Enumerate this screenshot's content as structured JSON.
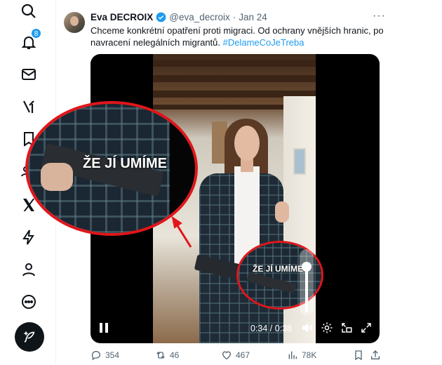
{
  "nav": {
    "notifications_badge": "8",
    "icons": [
      "search-icon",
      "bell-icon",
      "mail-icon",
      "grok-icon",
      "bookmark-icon",
      "communities-icon",
      "x-logo-icon",
      "bolt-icon",
      "profile-icon",
      "more-circle-icon"
    ]
  },
  "tweet": {
    "author_name": "Eva DECROIX",
    "handle": "@eva_decroix",
    "separator": "·",
    "date": "Jan 24",
    "text": "Chceme konkrétní opatření proti migraci. Od ochrany vnějších hranic, po navracení nelegálních migrantů.",
    "hashtag": "#DelameCoJeTreba",
    "more_label": "···"
  },
  "video": {
    "caption_small": "ŽE JÍ UMÍME",
    "caption_zoom": "ŽE JÍ UMÍME",
    "time": "0:34 / 0:38",
    "volume_level": 0.75,
    "annotation_color": "#e0161b"
  },
  "actions": {
    "replies": "354",
    "reposts": "46",
    "likes": "467",
    "views": "78K"
  },
  "colors": {
    "accent": "#1d9bf0",
    "text": "#0f1419",
    "muted": "#536471"
  }
}
